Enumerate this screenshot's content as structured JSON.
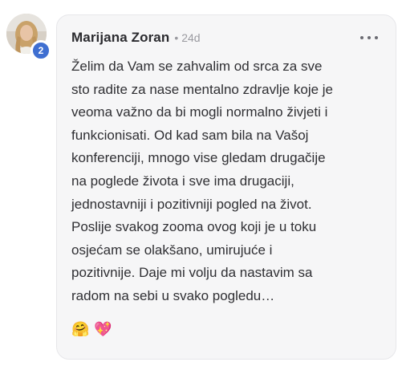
{
  "comment": {
    "author": "Marijana Zoran",
    "separator": "•",
    "age": "24d",
    "level": "2",
    "text": "Želim da Vam se zahvalim od srca za sve\nsto radite za nase mentalno zdravlje koje je\nveoma važno da bi mogli normalno živjeti i\nfunkcionisati. Od kad sam bila na Vašoj\nkonferenciji, mnogo vise gledam drugačije\nna poglede života i sve ima drugaciji,\njednostavniji i pozitivniji pogled na život.\nPoslije svakog zooma ovog koji je u toku\nosjećam se olakšano, umirujuće i\npozitivnije. Daje mi volju da nastavim sa\nradom na sebi u svako pogledu…",
    "reactions": [
      "🤗",
      "💖"
    ]
  },
  "icons": {
    "avatar": "avatar-photo",
    "more": "more-horizontal-icon",
    "badge_color": "#3f6fd1"
  }
}
